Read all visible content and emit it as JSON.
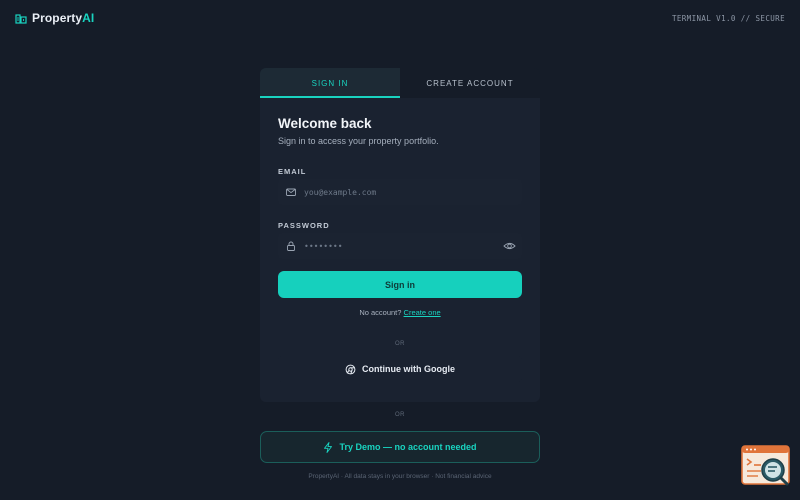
{
  "header": {
    "brand_name": "Property",
    "brand_suffix": "AI",
    "terminal_label": "TERMINAL V1.0 // SECURE"
  },
  "tabs": [
    {
      "label": "SIGN IN",
      "active": true
    },
    {
      "label": "CREATE ACCOUNT",
      "active": false
    }
  ],
  "form": {
    "title": "Welcome back",
    "subtitle": "Sign in to access your property portfolio.",
    "email_label": "EMAIL",
    "email_placeholder": "you@example.com",
    "email_value": "",
    "password_label": "PASSWORD",
    "password_placeholder": "••••••••",
    "password_value": "",
    "submit_label": "Sign in",
    "no_account_text": "No account?",
    "create_link": "Create one",
    "or_label": "OR",
    "google_label": "Continue with Google"
  },
  "demo": {
    "or_label": "OR",
    "label": "Try Demo — no account needed"
  },
  "footer": {
    "text": "PropertyAI · All data stays in your browser · Not financial advice"
  },
  "colors": {
    "accent": "#16d0bd",
    "background": "#151c28",
    "card": "#1a2230"
  },
  "icons": {
    "logo": "building-icon",
    "email": "mail-icon",
    "password": "lock-icon",
    "reveal": "eye-icon",
    "google": "google-icon",
    "demo": "lightning-icon",
    "help": "terminal-search-icon"
  }
}
